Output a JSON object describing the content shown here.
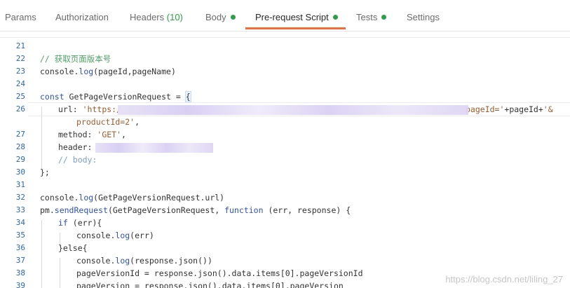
{
  "tabs": [
    {
      "label": "Params"
    },
    {
      "label": "Authorization"
    },
    {
      "label": "Headers",
      "count": "(10)"
    },
    {
      "label": "Body",
      "indicator": "green-dot"
    },
    {
      "label": "Pre-request Script",
      "indicator": "green-dot",
      "active": true
    },
    {
      "label": "Tests",
      "indicator": "green-dot"
    },
    {
      "label": "Settings"
    }
  ],
  "colors": {
    "accent": "#f26b3a",
    "indicator": "#2aa146"
  },
  "editor": {
    "lines": [
      {
        "n": "21"
      },
      {
        "n": "22",
        "comment": "// 获取页面版本号"
      },
      {
        "n": "23",
        "a": "console.",
        "b": "log",
        "c": "(pageId,pageName)"
      },
      {
        "n": "24"
      },
      {
        "n": "25",
        "kw": "const",
        "rest": " GetPageVersionRequest = ",
        "brace": "{"
      },
      {
        "n": "26",
        "key": "url: ",
        "str1": "'https:/",
        "str2": "pageId='",
        "mid": "+pageId+",
        "str3": "'&"
      },
      {
        "n": "",
        "str4": "productId=2'",
        "tail": ","
      },
      {
        "n": "27",
        "key": "method: ",
        "str": "'GET'",
        "tail": ","
      },
      {
        "n": "28",
        "key": "header: "
      },
      {
        "n": "29",
        "comment": "// body:"
      },
      {
        "n": "30",
        "text": "};"
      },
      {
        "n": "31"
      },
      {
        "n": "32",
        "a": "console.",
        "b": "log",
        "c": "(GetPageVersionRequest.url)"
      },
      {
        "n": "33",
        "a": "pm.",
        "b": "sendRequest",
        "c": "(GetPageVersionRequest, ",
        "kw": "function",
        "d": " (err, response) {"
      },
      {
        "n": "34",
        "kw": "if",
        "rest": " (err){"
      },
      {
        "n": "35",
        "a": "console.",
        "b": "log",
        "c": "(err)"
      },
      {
        "n": "36",
        "text": "}else{"
      },
      {
        "n": "37",
        "a": "console.",
        "b": "log",
        "c": "(response.json())"
      },
      {
        "n": "38",
        "text": "pageVersionId = response.json().data.items[0].pageVersionId"
      },
      {
        "n": "39",
        "text": "pageVersion = response.json().data.items[0].pageVersion"
      }
    ]
  },
  "watermark": "https://blog.csdn.net/liling_27"
}
